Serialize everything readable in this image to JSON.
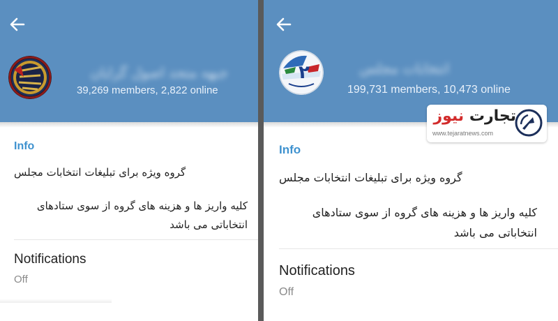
{
  "colors": {
    "header": "#5b8fc0",
    "info_label": "#3f92cf",
    "divider": "#5a5a5a",
    "watermark_red": "#d22b2b"
  },
  "left": {
    "title": "جبهه متحد اصول گرایان",
    "members": "39,269 members, 2,822 online",
    "info_label": "Info",
    "description_line1": "گروه ویژه برای تبلیغات انتخابات مجلس",
    "description_line2": "کلیه واریز ها و هزینه های گروه از سوی ستادهای انتخاباتی می باشد",
    "notifications_label": "Notifications",
    "notifications_value": "Off"
  },
  "right": {
    "title": "انتخابات مجلس",
    "members": "199,731 members, 10,473 online",
    "info_label": "Info",
    "description_line1": "گروه ویژه برای تبلیغات انتخابات مجلس",
    "description_line2": "کلیه واریز ها و هزینه های گروه از سوی ستادهای انتخاباتی می باشد",
    "notifications_label": "Notifications",
    "notifications_value": "Off"
  },
  "watermark": {
    "brand_part1": "تجارت",
    "brand_part2": "نیوز",
    "url": "www.tejaratnews.com"
  },
  "icons": {
    "back": "arrow-left-icon",
    "watermark_logo": "tejarat-logo-icon"
  }
}
